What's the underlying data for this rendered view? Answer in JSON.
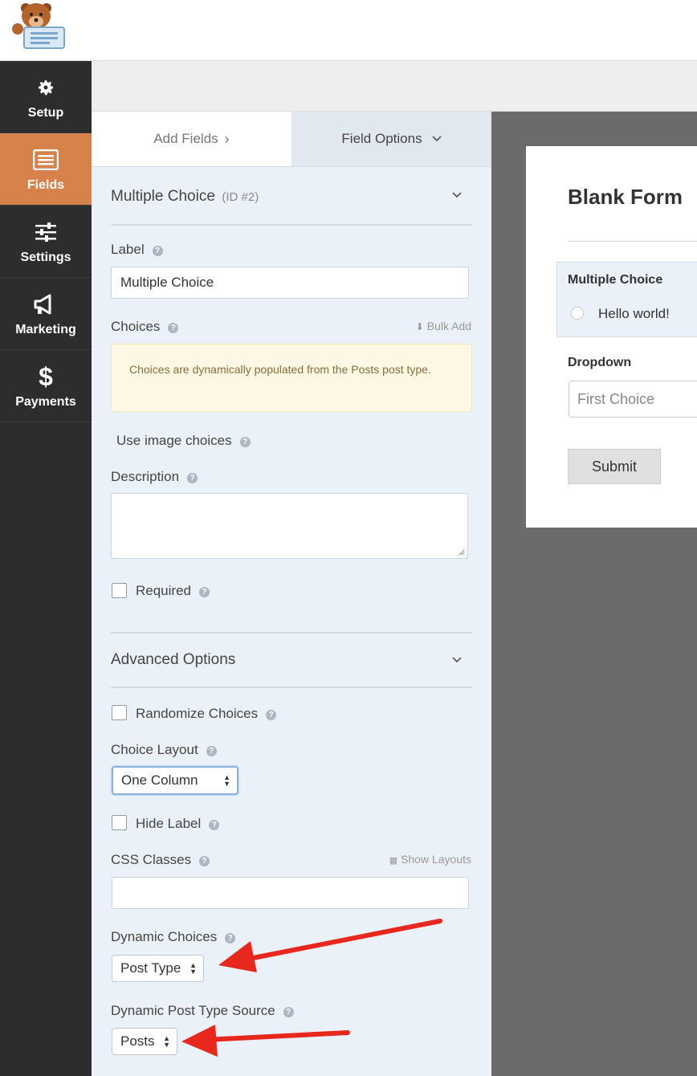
{
  "nav": {
    "items": [
      {
        "label": "Setup",
        "icon": "gear-icon"
      },
      {
        "label": "Fields",
        "icon": "fields-list-icon"
      },
      {
        "label": "Settings",
        "icon": "sliders-icon"
      },
      {
        "label": "Marketing",
        "icon": "megaphone-icon"
      },
      {
        "label": "Payments",
        "icon": "dollar-icon"
      }
    ],
    "active": "Fields",
    "accent": "#d6824a"
  },
  "tabs": {
    "add_fields": "Add Fields",
    "add_fields_chevron": "›",
    "field_options": "Field Options"
  },
  "field": {
    "type_name": "Multiple Choice",
    "id_text": "(ID #2)",
    "label_heading": "Label",
    "label_value": "Multiple Choice",
    "choices_heading": "Choices",
    "bulk_add": "Bulk Add",
    "notice": "Choices are dynamically populated from the Posts post type.",
    "image_choices": "Use image choices",
    "description_heading": "Description",
    "description_value": "",
    "required": "Required"
  },
  "advanced": {
    "heading": "Advanced Options",
    "randomize": "Randomize Choices",
    "choice_layout_heading": "Choice Layout",
    "choice_layout_value": "One Column",
    "hide_label": "Hide Label",
    "css_classes_heading": "CSS Classes",
    "show_layouts": "Show Layouts",
    "css_classes_value": "",
    "dynamic_choices_heading": "Dynamic Choices",
    "dynamic_choices_value": "Post Type",
    "dynamic_source_heading": "Dynamic Post Type Source",
    "dynamic_source_value": "Posts"
  },
  "preview": {
    "form_title": "Blank Form",
    "mc_label": "Multiple Choice",
    "mc_option": "Hello world!",
    "dropdown_label": "Dropdown",
    "dropdown_placeholder": "First Choice",
    "submit": "Submit"
  },
  "annotation_color": "#e8281d"
}
